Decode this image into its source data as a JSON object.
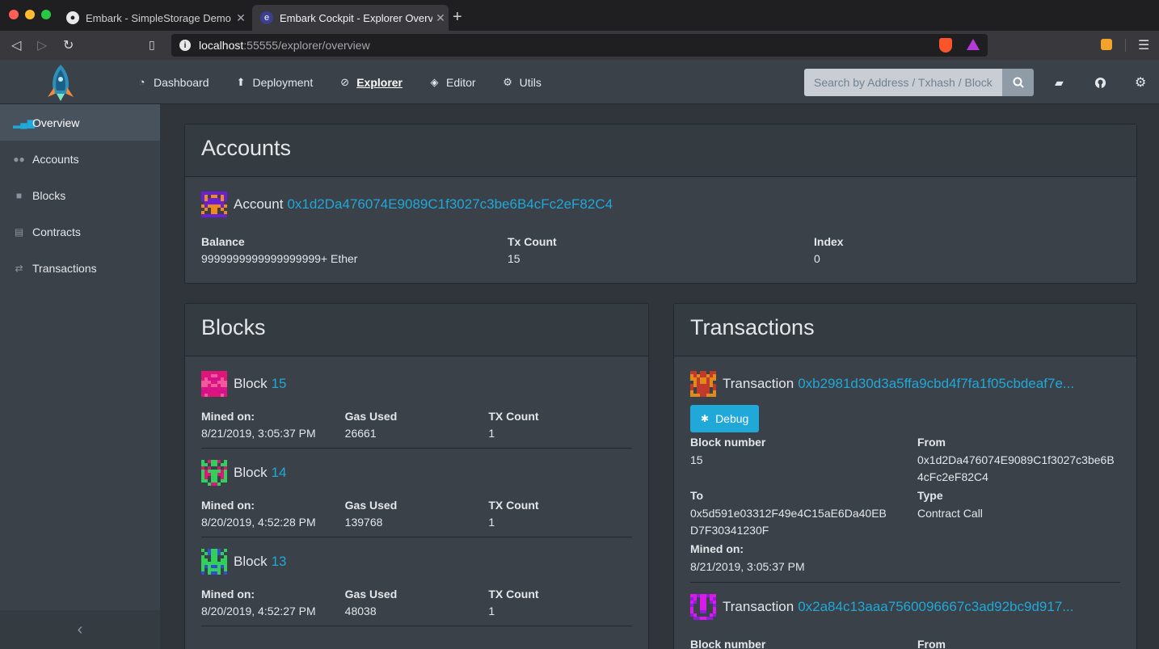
{
  "browser": {
    "tabs": [
      {
        "title": "Embark - SimpleStorage Demo",
        "active": false
      },
      {
        "title": "Embark Cockpit - Explorer Overview",
        "active": true
      }
    ],
    "url_host": "localhost",
    "url_rest": ":55555/explorer/overview"
  },
  "header": {
    "nav": [
      {
        "label": "Dashboard",
        "icon": "dashboard-icon"
      },
      {
        "label": "Deployment",
        "icon": "upload-icon"
      },
      {
        "label": "Explorer",
        "icon": "compass-icon",
        "active": true
      },
      {
        "label": "Editor",
        "icon": "codepen-icon"
      },
      {
        "label": "Utils",
        "icon": "gear-icon"
      }
    ],
    "search_placeholder": "Search by Address / Txhash / Block"
  },
  "sidebar": {
    "items": [
      {
        "label": "Overview",
        "icon": "signal-icon",
        "active": true
      },
      {
        "label": "Accounts",
        "icon": "users-icon"
      },
      {
        "label": "Blocks",
        "icon": "square-icon"
      },
      {
        "label": "Contracts",
        "icon": "file-icon"
      },
      {
        "label": "Transactions",
        "icon": "exchange-icon"
      }
    ]
  },
  "accounts": {
    "title": "Accounts",
    "account_label": "Account",
    "address": "0x1d2Da476074E9089C1f3027c3be6B4cFc2eF82C4",
    "balance_label": "Balance",
    "balance": "9999999999999999999+ Ether",
    "txcount_label": "Tx Count",
    "txcount": "15",
    "index_label": "Index",
    "index": "0"
  },
  "blocks": {
    "title": "Blocks",
    "block_label": "Block",
    "mined_label": "Mined on:",
    "gas_label": "Gas Used",
    "tx_label": "TX Count",
    "items": [
      {
        "number": "15",
        "mined": "8/21/2019, 3:05:37 PM",
        "gas": "26661",
        "tx": "1"
      },
      {
        "number": "14",
        "mined": "8/20/2019, 4:52:28 PM",
        "gas": "139768",
        "tx": "1"
      },
      {
        "number": "13",
        "mined": "8/20/2019, 4:52:27 PM",
        "gas": "48038",
        "tx": "1"
      }
    ]
  },
  "transactions": {
    "title": "Transactions",
    "tx_label": "Transaction",
    "debug_label": "Debug",
    "block_number_label": "Block number",
    "from_label": "From",
    "to_label": "To",
    "type_label": "Type",
    "mined_label": "Mined on:",
    "items": [
      {
        "hash": "0xb2981d30d3a5ffa9cbd4f7fa1f05cbdeaf7e...",
        "block_number": "15",
        "from": "0x1d2Da476074E9089C1f3027c3be6B4cFc2eF82C4",
        "to": "0x5d591e03312F49e4C15aE6Da40EBD7F30341230F",
        "type": "Contract Call",
        "mined": "8/21/2019, 3:05:37 PM"
      },
      {
        "hash": "0x2a84c13aaa7560096667c3ad92bc9d917..."
      }
    ]
  },
  "colors": {
    "accent": "#20a8d8",
    "header_bg": "#3a4149",
    "body_bg": "#2f353a"
  }
}
